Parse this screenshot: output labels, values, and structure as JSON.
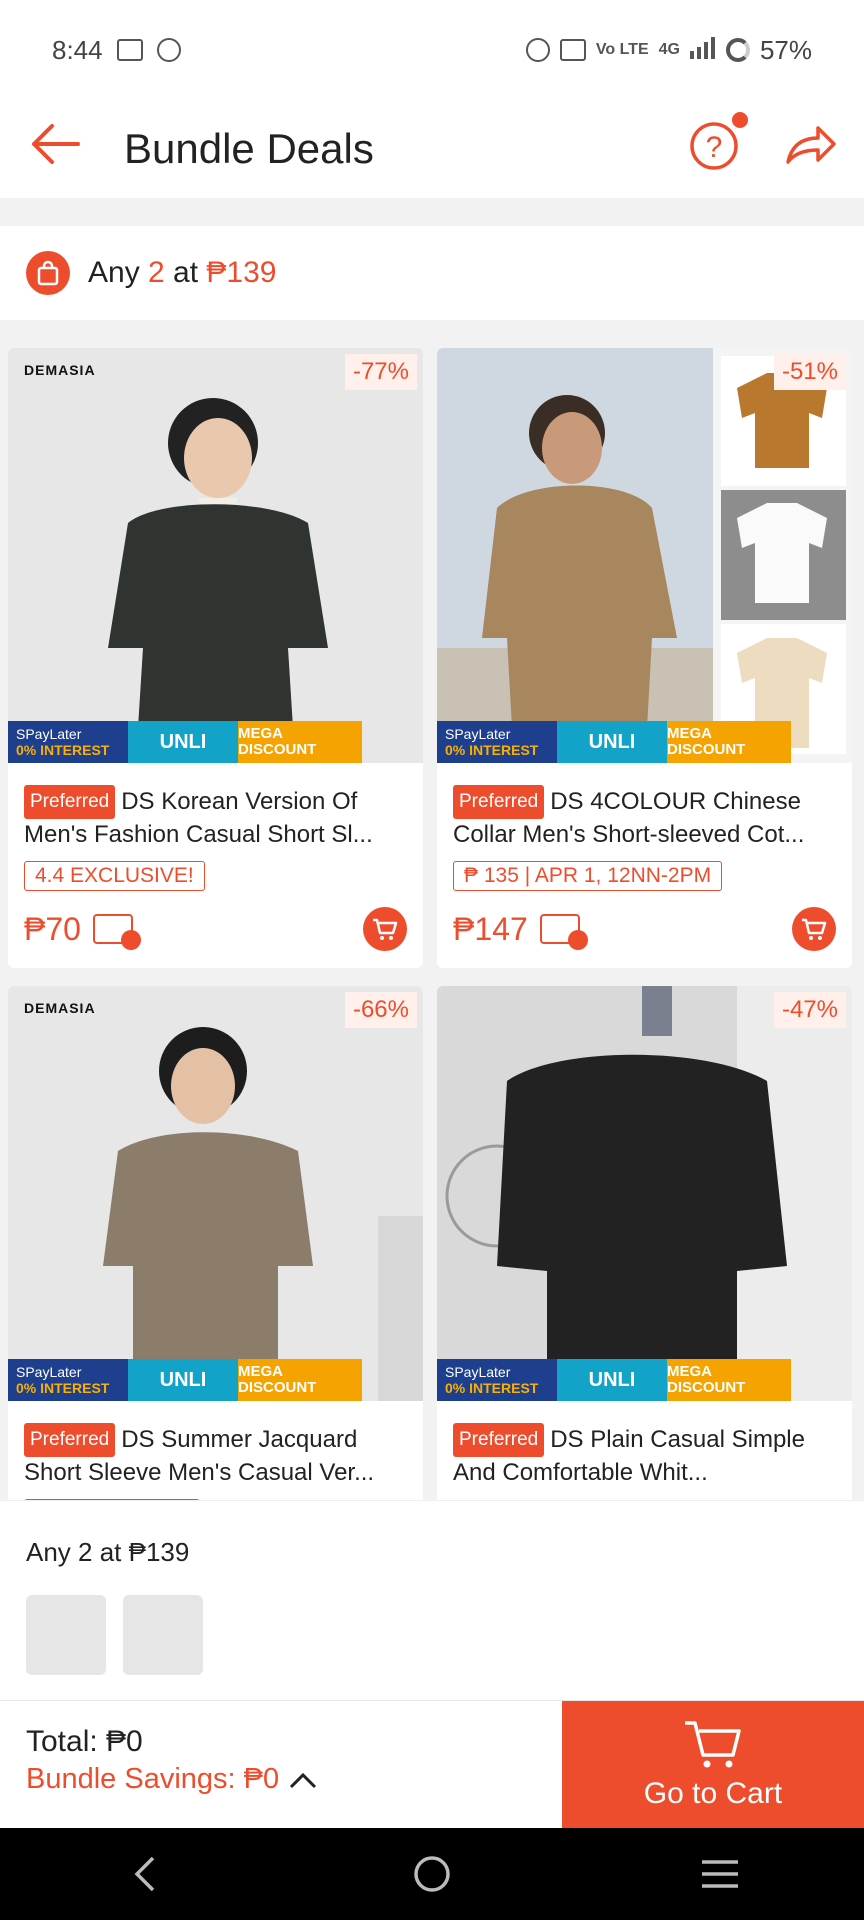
{
  "status_bar": {
    "time": "8:44",
    "network": "4G",
    "lte": "Vo LTE",
    "battery": "57%"
  },
  "header": {
    "title": "Bundle Deals",
    "icons": [
      "back-arrow-icon",
      "help-icon",
      "share-icon"
    ]
  },
  "bundle": {
    "prefix": "Any ",
    "qty": "2",
    "middle": " at ",
    "price": "₱139"
  },
  "products": [
    {
      "brand": "DEMASIA",
      "discount": "-77%",
      "badge": "Preferred",
      "title": "DS Korean Version Of Men's Fashion Casual Short Sl...",
      "tag": "4.4 EXCLUSIVE!",
      "price": "₱70",
      "promo": {
        "spay": "SPayLater",
        "interest": "0% INTEREST",
        "unli": "UNLI",
        "mega": "MEGA DISCOUNT"
      }
    },
    {
      "brand": "",
      "discount": "-51%",
      "badge": "Preferred",
      "title": "DS 4COLOUR Chinese Collar Men's Short-sleeved Cot...",
      "tag": "₱ 135  | APR 1, 12NN-2PM",
      "price": "₱147",
      "promo": {
        "spay": "SPayLater",
        "interest": "0% INTEREST",
        "unli": "UNLI",
        "mega": "MEGA DISCOUNT"
      }
    },
    {
      "brand": "DEMASIA",
      "discount": "-66%",
      "badge": "Preferred",
      "title": "DS Summer Jacquard Short Sleeve Men's Casual Ver...",
      "promo": {
        "spay": "SPayLater",
        "interest": "0% INTEREST",
        "unli": "UNLI",
        "mega": "MEGA DISCOUNT"
      }
    },
    {
      "brand": "",
      "discount": "-47%",
      "badge": "Preferred",
      "title": "DS Plain Casual Simple And Comfortable Whit...",
      "promo": {
        "spay": "SPayLater",
        "interest": "0% INTEREST",
        "unli": "UNLI",
        "mega": "MEGA DISCOUNT"
      }
    }
  ],
  "tray": {
    "title": "Any 2 at ₱139"
  },
  "checkout": {
    "total": "Total: ₱0",
    "savings": "Bundle Savings: ₱0",
    "go_to_cart": "Go to Cart"
  },
  "colors": {
    "accent": "#ee4d2d"
  }
}
